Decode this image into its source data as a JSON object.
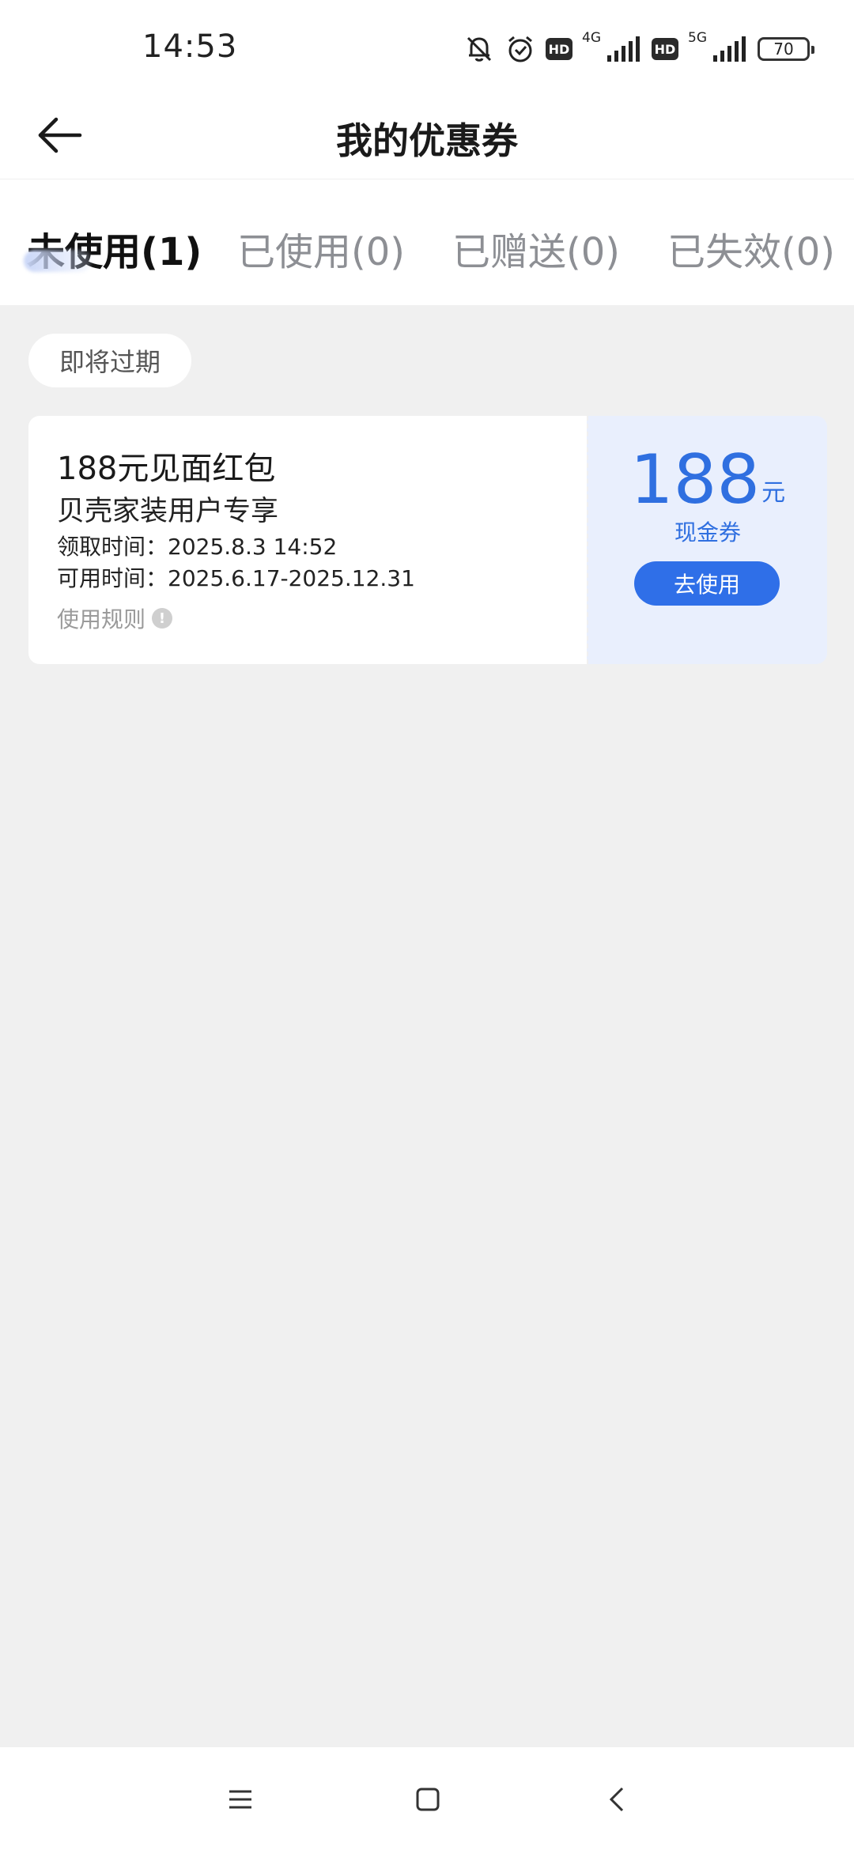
{
  "status_bar": {
    "time": "14:53",
    "network_1": "4G",
    "network_2": "5G",
    "hd_label": "HD",
    "battery": "70"
  },
  "nav": {
    "title": "我的优惠券"
  },
  "tabs": [
    {
      "label": "未使用(1)",
      "active": true
    },
    {
      "label": "已使用(0)",
      "active": false
    },
    {
      "label": "已赠送(0)",
      "active": false
    },
    {
      "label": "已失效(0)",
      "active": false
    }
  ],
  "section": {
    "label": "即将过期"
  },
  "coupon": {
    "title": "188元见面红包",
    "subtitle": "贝壳家装用户专享",
    "received_time": "领取时间：2025.8.3 14:52",
    "valid_time": "可用时间：2025.6.17-2025.12.31",
    "rules_label": "使用规则",
    "amount": "188",
    "unit": "元",
    "type": "现金券",
    "use_button": "去使用"
  },
  "colors": {
    "accent": "#2f6fe8",
    "coupon_right_bg": "#e9effd",
    "page_bg": "#f0f0f0"
  }
}
